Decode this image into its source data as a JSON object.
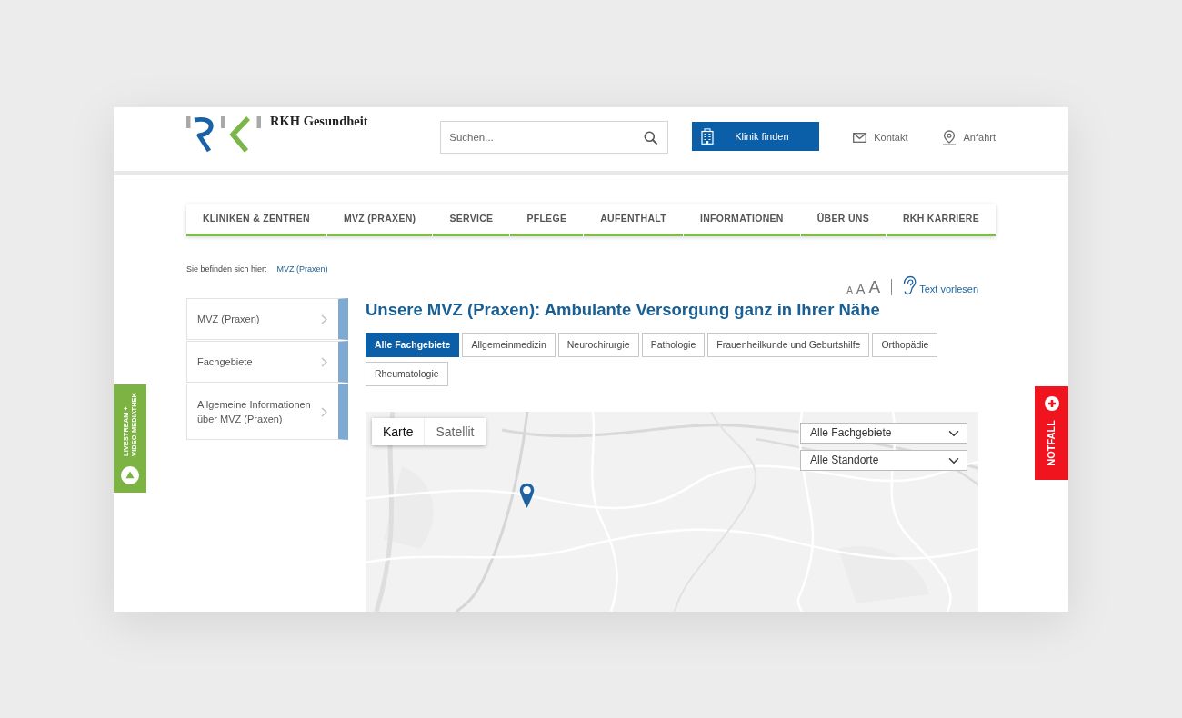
{
  "header": {
    "brand": "RKH Gesundheit",
    "search": {
      "placeholder": "Suchen..."
    },
    "cta": "Klinik finden",
    "links": [
      {
        "kind": "mail",
        "label": "Kontakt"
      },
      {
        "kind": "location",
        "label": "Anfahrt"
      }
    ]
  },
  "nav": {
    "items": [
      "KLINIKEN & ZENTREN",
      "MVZ (PRAXEN)",
      "SERVICE",
      "PFLEGE",
      "AUFENTHALT",
      "INFORMATIONEN",
      "ÜBER UNS",
      "RKH KARRIERE"
    ]
  },
  "breadcrumb": {
    "label": "Sie befinden sich hier:",
    "items": [
      "MVZ (Praxen)"
    ]
  },
  "text_tools": {
    "sizes": [
      "A",
      "A",
      "A"
    ],
    "read_aloud": "Text vorlesen"
  },
  "sidebar": {
    "items": [
      "MVZ (Praxen)",
      "Fachgebiete",
      "Allgemeine Informationen über MVZ (Praxen)"
    ]
  },
  "title": "Unsere MVZ (Praxen): Ambulante Versorgung ganz in Ihrer Nähe",
  "filters": [
    {
      "label": "Alle Fachgebiete",
      "selected": true
    },
    {
      "label": "Allgemeinmedizin",
      "selected": false
    },
    {
      "label": "Neurochirurgie",
      "selected": false
    },
    {
      "label": "Pathologie",
      "selected": false
    },
    {
      "label": "Frauenheilkunde und Geburtshilfe",
      "selected": false
    },
    {
      "label": "Orthopädie",
      "selected": false
    },
    {
      "label": "Rheumatologie",
      "selected": false
    }
  ],
  "map": {
    "types": [
      {
        "label": "Karte",
        "selected": true
      },
      {
        "label": "Satellit",
        "selected": false
      }
    ],
    "selects": [
      "Alle Fachgebiete",
      "Alle Standorte"
    ]
  },
  "side_tabs": [
    {
      "kind": "livestream",
      "lines": [
        "LIVESTREAM +",
        "VIDEO-MEDIATHEK"
      ]
    },
    {
      "kind": "emergency",
      "lines": [
        "NOTFALL"
      ]
    }
  ]
}
